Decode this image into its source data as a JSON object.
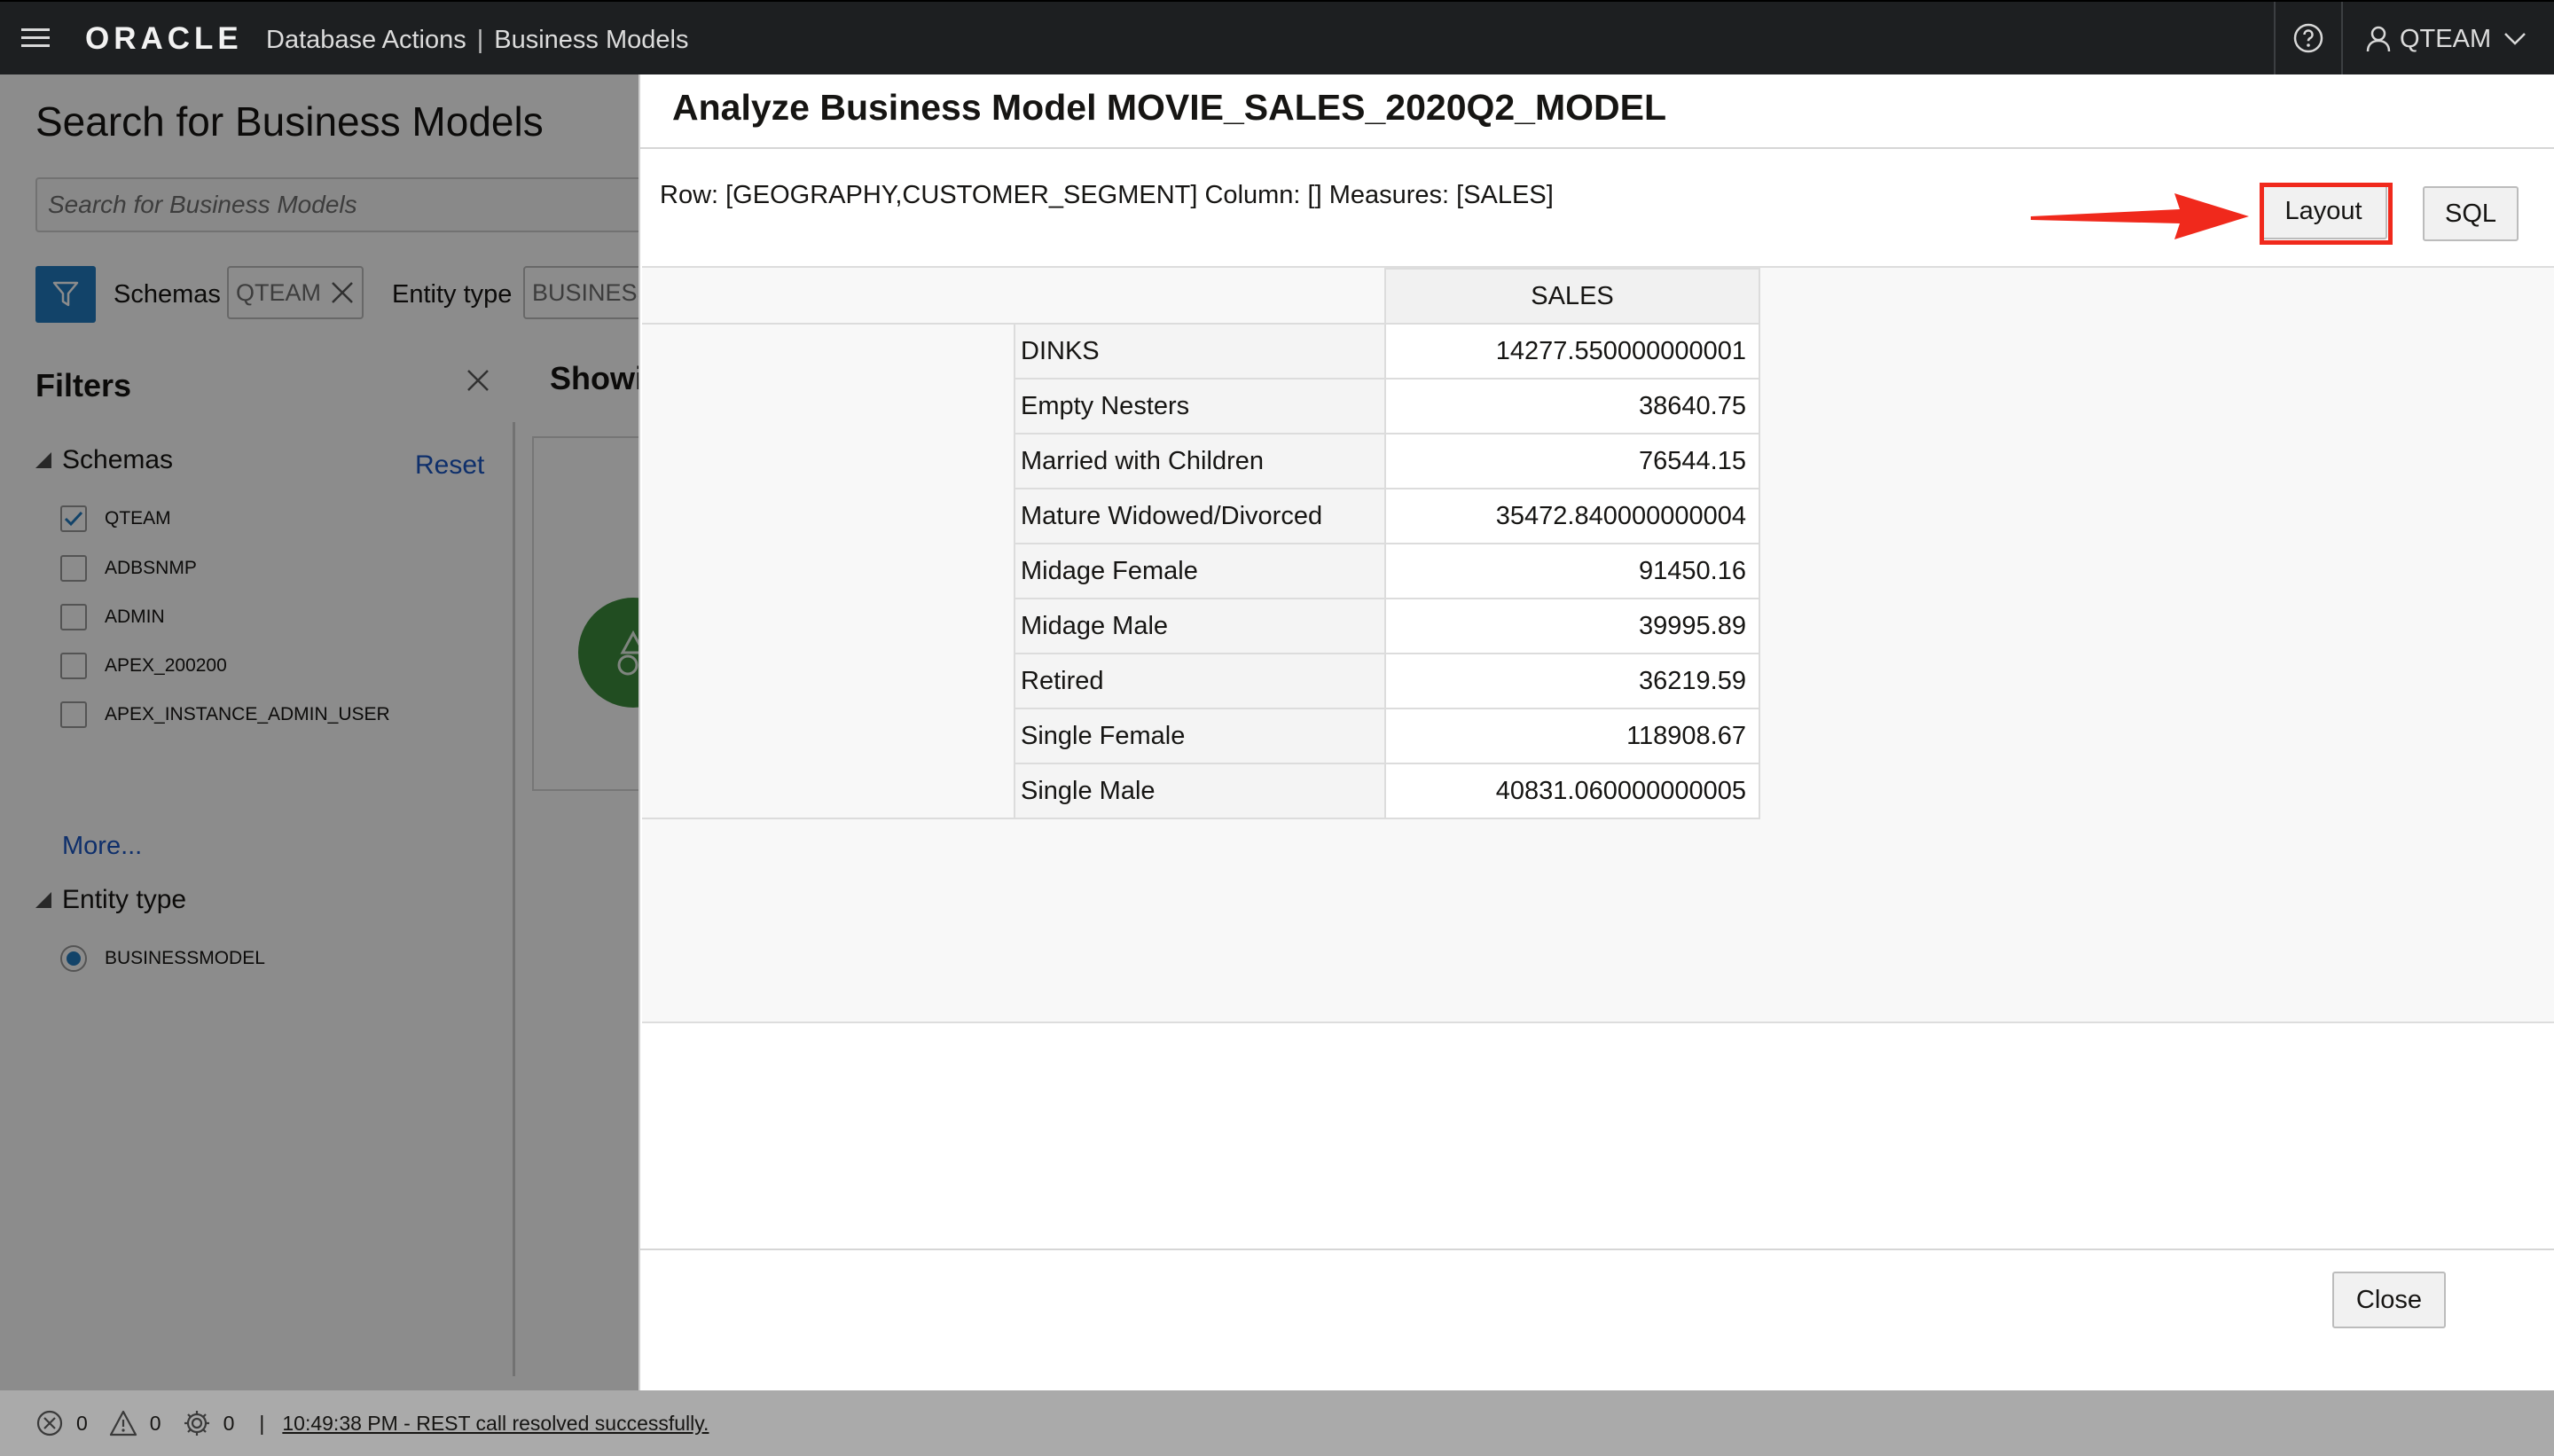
{
  "topbar": {
    "brand": "ORACLE",
    "app_name": "Database Actions",
    "separator": "|",
    "section": "Business Models",
    "user": "QTEAM",
    "icons": [
      "menu-icon",
      "help-icon",
      "user-icon",
      "chevron-down-icon"
    ]
  },
  "background": {
    "page_title": "Search for Business Models",
    "search_placeholder": "Search for Business Models",
    "filter_chips": [
      {
        "label": "Schemas",
        "value": "QTEAM"
      },
      {
        "label": "Entity type",
        "value": "BUSINESS"
      }
    ],
    "filters": {
      "title": "Filters",
      "schemas_heading": "Schemas",
      "reset_label": "Reset",
      "schemas": [
        {
          "name": "QTEAM",
          "checked": true
        },
        {
          "name": "ADBSNMP",
          "checked": false
        },
        {
          "name": "ADMIN",
          "checked": false
        },
        {
          "name": "APEX_200200",
          "checked": false
        },
        {
          "name": "APEX_INSTANCE_ADMIN_USER",
          "checked": false
        }
      ],
      "more_label": "More...",
      "entity_heading": "Entity type",
      "entity_types": [
        {
          "name": "BUSINESSMODEL",
          "selected": true
        }
      ]
    },
    "results_heading": "Showi"
  },
  "modal": {
    "title": "Analyze Business Model MOVIE_SALES_2020Q2_MODEL",
    "query_summary": "Row: [GEOGRAPHY,CUSTOMER_SEGMENT] Column: [] Measures: [SALES]",
    "layout_label": "Layout",
    "sql_label": "SQL",
    "close_label": "Close",
    "table": {
      "measure_header": "SALES",
      "rows": [
        {
          "segment": "DINKS",
          "sales": "14277.550000000001"
        },
        {
          "segment": "Empty Nesters",
          "sales": "38640.75"
        },
        {
          "segment": "Married with Children",
          "sales": "76544.15"
        },
        {
          "segment": "Mature Widowed/Divorced",
          "sales": "35472.840000000004"
        },
        {
          "segment": "Midage Female",
          "sales": "91450.16"
        },
        {
          "segment": "Midage Male",
          "sales": "39995.89"
        },
        {
          "segment": "Retired",
          "sales": "36219.59"
        },
        {
          "segment": "Single Female",
          "sales": "118908.67"
        },
        {
          "segment": "Single Male",
          "sales": "40831.060000000005"
        }
      ]
    }
  },
  "statusbar": {
    "error_count": "0",
    "warning_count": "0",
    "task_count": "0",
    "separator": "|",
    "message": "10:49:38 PM - REST call resolved successfully."
  },
  "colors": {
    "topbar_bg": "#1d1f21",
    "accent_blue": "#227bbf",
    "highlight_red": "#f0291c",
    "link_blue": "#1a56c4"
  }
}
